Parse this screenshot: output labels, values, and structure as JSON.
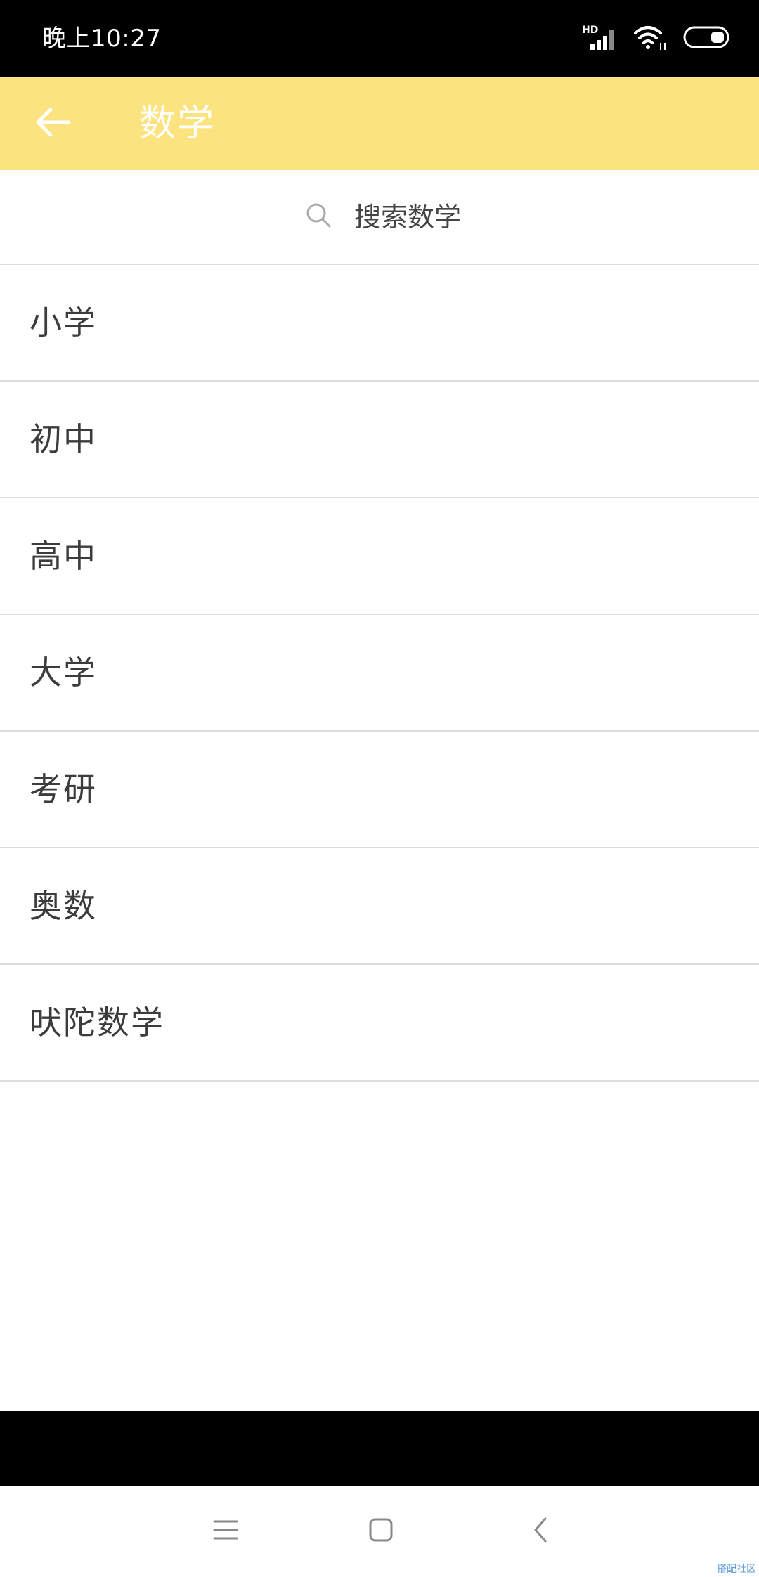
{
  "status_bar": {
    "time": "晚上10:27",
    "network_label": "HD",
    "icons": [
      "signal-icon",
      "wifi-icon",
      "battery-icon"
    ]
  },
  "app_bar": {
    "title": "数学",
    "back_icon": "arrow-left-icon",
    "background_color": "#fbe37f"
  },
  "search": {
    "icon": "search-icon",
    "placeholder": "搜索数学"
  },
  "list": {
    "items": [
      {
        "label": "小学"
      },
      {
        "label": "初中"
      },
      {
        "label": "高中"
      },
      {
        "label": "大学"
      },
      {
        "label": "考研"
      },
      {
        "label": "奥数"
      },
      {
        "label": "吠陀数学"
      }
    ]
  },
  "nav_bar": {
    "icons": [
      "menu-icon",
      "home-icon",
      "back-icon"
    ]
  },
  "watermark": "搭配社区"
}
